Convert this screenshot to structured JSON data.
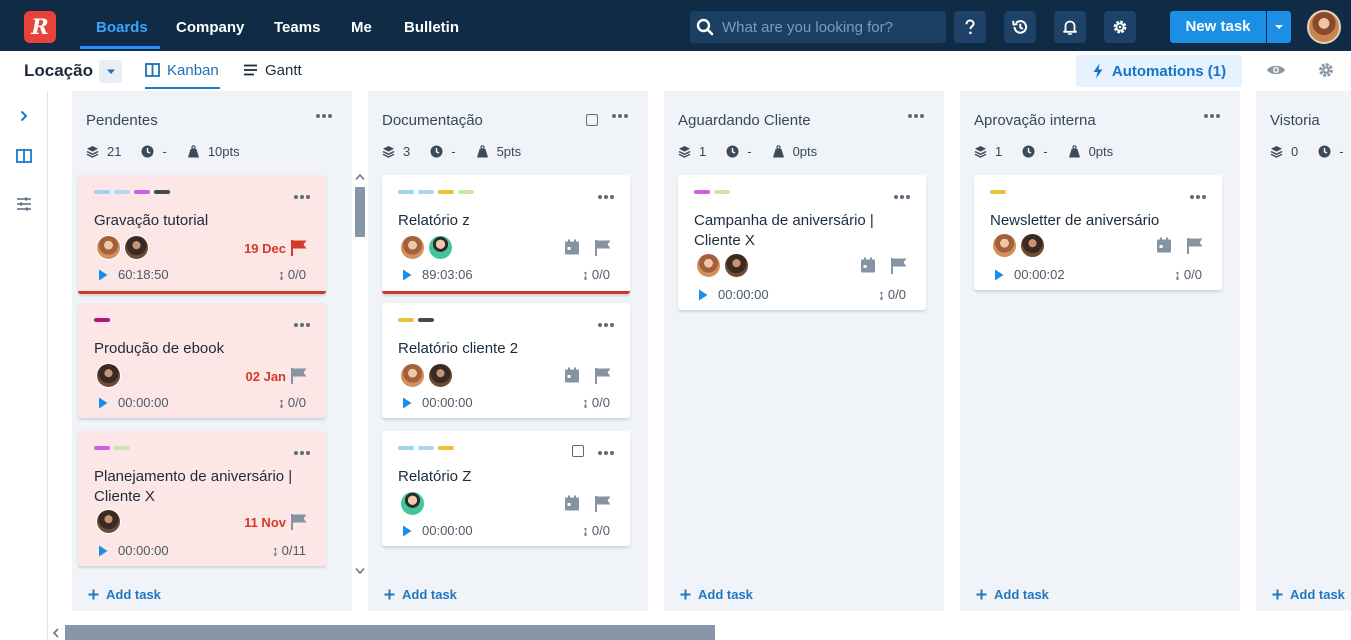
{
  "app": {
    "logo_letter": "R"
  },
  "nav": {
    "items": [
      "Boards",
      "Company",
      "Teams",
      "Me",
      "Bulletin"
    ],
    "active": "Boards"
  },
  "search": {
    "placeholder": "What are you looking for?"
  },
  "toolbar": {
    "icons": [
      "help-icon",
      "history-icon",
      "bell-icon",
      "gear-icon"
    ],
    "new_task_label": "New task"
  },
  "board": {
    "title": "Locação",
    "views": [
      "Kanban",
      "Gantt"
    ],
    "active_view": "Kanban",
    "automations_label": "Automations (1)"
  },
  "columns": [
    {
      "title": "Pendentes",
      "count": "21",
      "time": "-",
      "points": "10pts",
      "add_label": "Add task",
      "cards": [
        {
          "title": "Gravação tutorial",
          "date": "19 Dec",
          "timer": "60:18:50",
          "subtasks": "0/0",
          "tags": [
            "#9fd3f2",
            "#a9d8f5",
            "#d05ce3",
            "#3f4a58"
          ]
        },
        {
          "title": "Produção de ebook",
          "date": "02 Jan",
          "timer": "00:00:00",
          "subtasks": "0/0",
          "tags": [
            "#b5157a"
          ]
        },
        {
          "title": "Planejamento de aniversário | Cliente X",
          "date": "11 Nov",
          "timer": "00:00:00",
          "subtasks": "0/11",
          "tags": [
            "#d05ce3",
            "#c9e8b0"
          ]
        }
      ]
    },
    {
      "title": "Documentação",
      "count": "3",
      "time": "-",
      "points": "5pts",
      "add_label": "Add task",
      "cards": [
        {
          "title": "Relatório z",
          "timer": "89:03:06",
          "subtasks": "0/0",
          "tags": [
            "#9fd3f2",
            "#a9d8f5",
            "#e8c23a",
            "#c9e8b0"
          ]
        },
        {
          "title": "Relatório cliente 2",
          "timer": "00:00:00",
          "subtasks": "0/0",
          "tags": [
            "#e8c23a",
            "#3f4a58"
          ]
        },
        {
          "title": "Relatório Z",
          "timer": "00:00:00",
          "subtasks": "0/0",
          "tags": [
            "#9fd3f2",
            "#a9d8f5",
            "#e8c23a"
          ]
        }
      ]
    },
    {
      "title": "Aguardando Cliente",
      "count": "1",
      "time": "-",
      "points": "0pts",
      "add_label": "Add task",
      "cards": [
        {
          "title": "Campanha de aniversário | Cliente X",
          "timer": "00:00:00",
          "subtasks": "0/0",
          "tags": [
            "#d05ce3",
            "#c9e8b0"
          ]
        }
      ]
    },
    {
      "title": "Aprovação interna",
      "count": "1",
      "time": "-",
      "points": "0pts",
      "add_label": "Add task",
      "cards": [
        {
          "title": "Newsletter de aniversário",
          "timer": "00:00:02",
          "subtasks": "0/0",
          "tags": [
            "#e8c23a"
          ]
        }
      ]
    },
    {
      "title": "Vistoria",
      "count": "0",
      "time": "-",
      "points": "",
      "add_label": "Add task",
      "cards": []
    }
  ],
  "colors": {
    "topbar": "#0f2b46",
    "accent": "#1b8fe3",
    "overdue": "#d23b2a",
    "card_pink": "#fde6e6"
  }
}
